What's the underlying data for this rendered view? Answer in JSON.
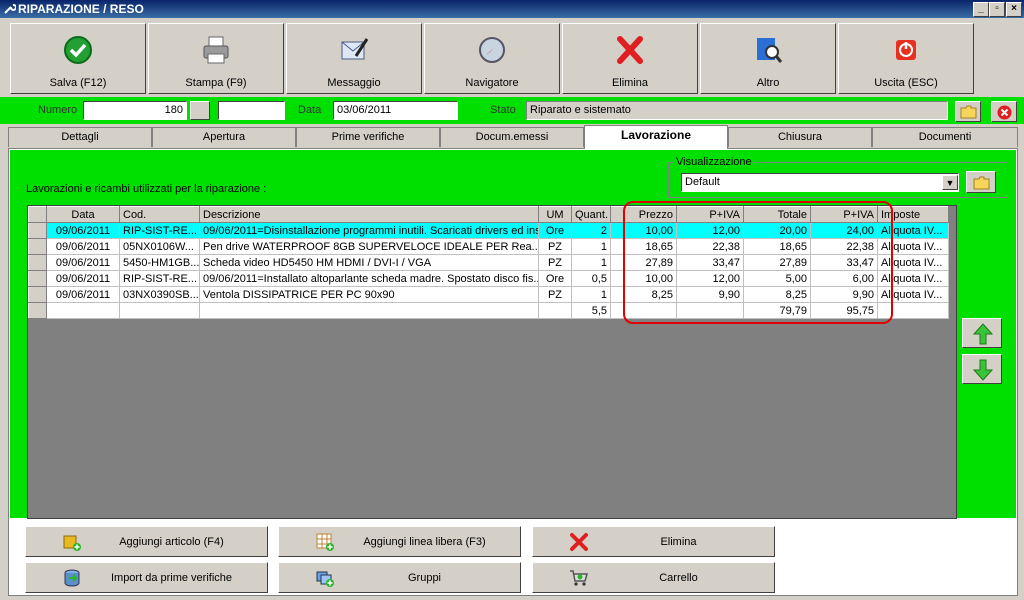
{
  "window": {
    "title": "RIPARAZIONE / RESO"
  },
  "toolbar": [
    {
      "label": "Salva (F12)",
      "icon": "check-icon"
    },
    {
      "label": "Stampa (F9)",
      "icon": "printer-icon"
    },
    {
      "label": "Messaggio",
      "icon": "message-icon"
    },
    {
      "label": "Navigatore",
      "icon": "compass-icon"
    },
    {
      "label": "Elimina",
      "icon": "delete-x-icon"
    },
    {
      "label": "Altro",
      "icon": "magnifier-icon"
    },
    {
      "label": "Uscita (ESC)",
      "icon": "power-icon"
    }
  ],
  "header": {
    "numero_label": "Numero",
    "numero_value": "180",
    "extra_value": "",
    "data_label": "Data",
    "data_value": "03/06/2011",
    "stato_label": "Stato",
    "stato_value": "Riparato e sistemato"
  },
  "tabs": [
    "Dettagli",
    "Apertura",
    "Prime verifiche",
    "Docum.emessi",
    "Lavorazione",
    "Chiusura",
    "Documenti"
  ],
  "active_tab": "Lavorazione",
  "content": {
    "intro": "Lavorazioni e ricambi utilizzati per la riparazione :",
    "visualizzazione_label": "Visualizzazione",
    "visualizzazione_value": "Default"
  },
  "table": {
    "columns": [
      "Data",
      "Cod.",
      "Descrizione",
      "UM",
      "Quant.",
      "Prezzo",
      "P+IVA",
      "Totale",
      "P+IVA",
      "Imposte"
    ],
    "rows": [
      [
        "09/06/2011",
        "RIP-SIST-RE...",
        "09/06/2011=Disinstallazione programmi inutili. Scaricati drivers ed ins...",
        "Ore",
        "2",
        "10,00",
        "12,00",
        "20,00",
        "24,00",
        "Aliquota IV..."
      ],
      [
        "09/06/2011",
        "05NX0106W...",
        "Pen drive WATERPROOF 8GB SUPERVELOCE IDEALE PER Rea...",
        "PZ",
        "1",
        "18,65",
        "22,38",
        "18,65",
        "22,38",
        "Aliquota IV..."
      ],
      [
        "09/06/2011",
        "5450-HM1GB...",
        "Scheda video HD5450 HM HDMI / DVI-I / VGA",
        "PZ",
        "1",
        "27,89",
        "33,47",
        "27,89",
        "33,47",
        "Aliquota IV..."
      ],
      [
        "09/06/2011",
        "RIP-SIST-RE...",
        "09/06/2011=Installato altoparlante scheda madre. Spostato disco fis...",
        "Ore",
        "0,5",
        "10,00",
        "12,00",
        "5,00",
        "6,00",
        "Aliquota IV..."
      ],
      [
        "09/06/2011",
        "03NX0390SB...",
        "Ventola DISSIPATRICE PER PC 90x90",
        "PZ",
        "1",
        "8,25",
        "9,90",
        "8,25",
        "9,90",
        "Aliquota IV..."
      ]
    ],
    "totals": {
      "quant": "5,5",
      "totale": "79,79",
      "piva": "95,75"
    }
  },
  "bottom_buttons": [
    {
      "label": "Aggiungi articolo (F4)",
      "icon": "box-add-icon"
    },
    {
      "label": "Aggiungi linea libera (F3)",
      "icon": "grid-add-icon"
    },
    {
      "label": "Elimina",
      "icon": "delete-x-icon"
    },
    {
      "label": "Import da prime verifiche",
      "icon": "import-icon"
    },
    {
      "label": "Gruppi",
      "icon": "group-add-icon"
    },
    {
      "label": "Carrello",
      "icon": "cart-icon"
    }
  ],
  "colors": {
    "highlight_green": "#00e000",
    "selected_row": "#00ffff",
    "annotation_red": "#e00000"
  }
}
